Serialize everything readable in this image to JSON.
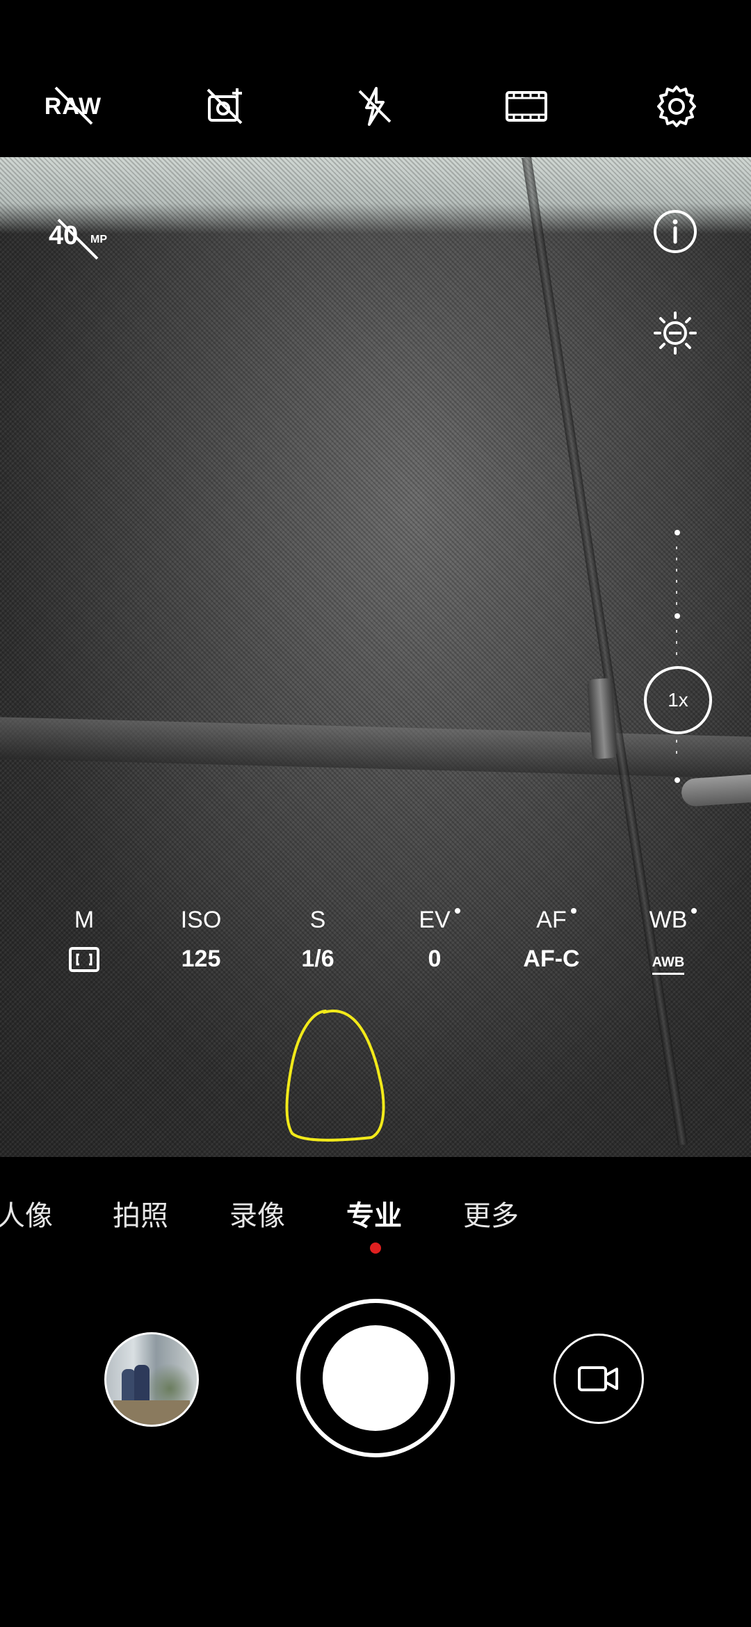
{
  "topbar": {
    "raw_label": "RAW",
    "icons": [
      "raw-off-icon",
      "ai-scene-off-icon",
      "flash-off-icon",
      "aspect-ratio-icon",
      "settings-gear-icon"
    ]
  },
  "viewfinder": {
    "megapixel_label": "40",
    "megapixel_unit": "MP",
    "zoom_label": "1x"
  },
  "pro_params": [
    {
      "label": "M",
      "value": ""
    },
    {
      "label": "ISO",
      "value": "125"
    },
    {
      "label": "S",
      "value": "1/6"
    },
    {
      "label": "EV",
      "value": "0"
    },
    {
      "label": "AF",
      "value": "AF-C"
    },
    {
      "label": "WB",
      "value": "AWB"
    }
  ],
  "modes": [
    "人像",
    "拍照",
    "录像",
    "专业",
    "更多"
  ],
  "active_mode": "专业",
  "colors": {
    "active_dot": "#e02020",
    "annotation": "#f2ea1a"
  }
}
